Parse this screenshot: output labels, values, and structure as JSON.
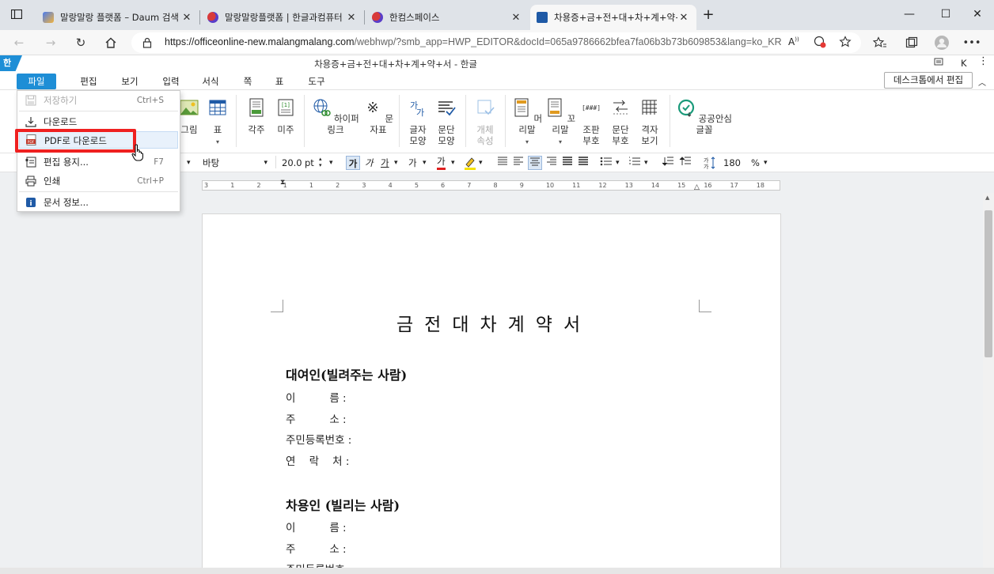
{
  "browser": {
    "tabs": [
      {
        "title": "말랑말랑 플랫폼 – Daum 검색",
        "icon": "daum-icon",
        "color": "#6b8df5"
      },
      {
        "title": "말랑말랑플랫폼 | 한글과컴퓨터",
        "icon": "hancom-icon",
        "color": "#c0392b"
      },
      {
        "title": "한컴스페이스",
        "icon": "hancom-icon",
        "color": "#c0392b"
      },
      {
        "title": "차용증+금+전+대+차+계+약+서",
        "icon": "hwp-icon",
        "color": "#1f5aa6"
      }
    ],
    "url_main": "https://officeonline-new.malangmalang.com",
    "url_rest": "/webhwp/?smb_app=HWP_EDITOR&docId=065a9786662bfea7fa06b3b73b609853&lang=ko_KR"
  },
  "app": {
    "title": "차용증+금+전+대+차+계+약+서 - 한글",
    "logo": "한",
    "user_initial": "K",
    "desktop_edit": "데스크톱에서 편집"
  },
  "menus": [
    "파일",
    "편집",
    "보기",
    "입력",
    "서식",
    "쪽",
    "표",
    "도구"
  ],
  "ribbon": {
    "image": "그림",
    "table": "표",
    "footnote": "각주",
    "endnote": "미주",
    "hyperlink": "하이퍼링크",
    "symbol": "문자표",
    "char_shape_1": "글자",
    "char_shape_2": "모양",
    "para_shape_1": "문단",
    "para_shape_2": "모양",
    "object_1": "개체",
    "object_2": "속성",
    "header": "머리말",
    "footer": "꼬리말",
    "assembly_1": "조판",
    "assembly_2": "부호",
    "para_mark_1": "문단",
    "para_mark_2": "부호",
    "grid_1": "격자",
    "grid_2": "보기",
    "public_font": "공공안심글꼴"
  },
  "format": {
    "font": "바탕",
    "size": "20.0",
    "unit": "pt",
    "bold": "가",
    "italic": "가",
    "underline": "가",
    "strike": "가",
    "color_a": "가",
    "line_spacing": "180",
    "percent": "%"
  },
  "ruler_numbers": [
    "3",
    "1",
    "2",
    "1",
    "1",
    "2",
    "3",
    "4",
    "5",
    "6",
    "7",
    "8",
    "9",
    "10",
    "11",
    "12",
    "13",
    "14",
    "15",
    "16",
    "17",
    "18"
  ],
  "file_menu": [
    {
      "label": "저장하기",
      "shortcut": "Ctrl+S",
      "icon": "save-icon",
      "disabled": true
    },
    {
      "label": "다운로드",
      "shortcut": "",
      "icon": "download-icon",
      "disabled": false
    },
    {
      "label": "PDF로 다운로드",
      "shortcut": "",
      "icon": "pdf-icon",
      "disabled": false
    },
    {
      "label": "편집 용지...",
      "shortcut": "F7",
      "icon": "page-setup-icon",
      "disabled": false
    },
    {
      "label": "인쇄",
      "shortcut": "Ctrl+P",
      "icon": "print-icon",
      "disabled": false
    },
    {
      "label": "문서 정보...",
      "shortcut": "",
      "icon": "info-icon",
      "disabled": false
    }
  ],
  "document": {
    "title": "금전대차계약서",
    "lender_heading": "대여인(빌려주는 사람)",
    "lender_fields": [
      "이          름 :",
      "주          소 :",
      "주민등록번호 :",
      "연    락    처 :"
    ],
    "borrower_heading": "차용인 (빌리는 사람)",
    "borrower_fields": [
      "이          름 :",
      "주          소 :",
      "주민등록번호 :"
    ]
  }
}
